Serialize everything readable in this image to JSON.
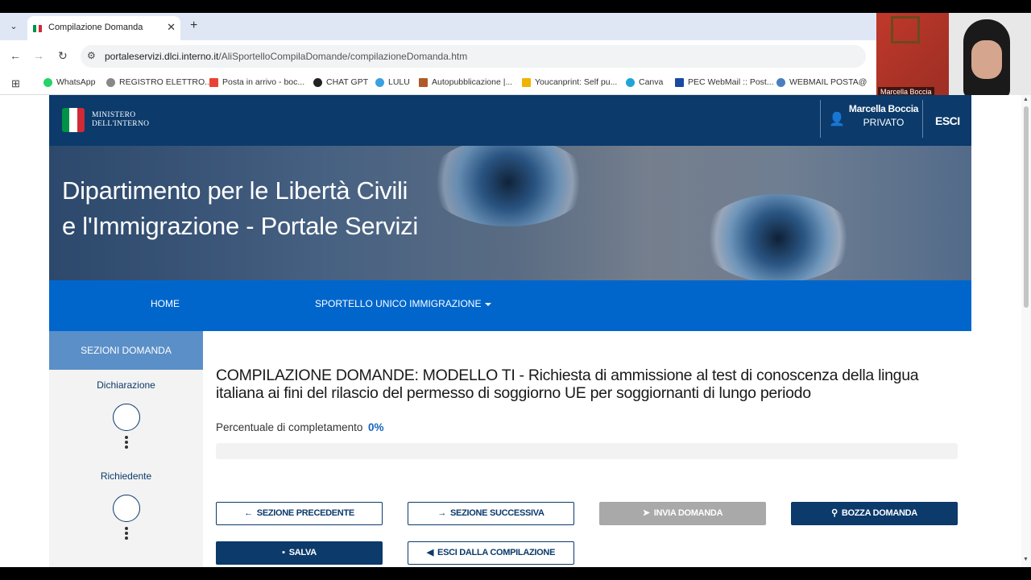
{
  "browser": {
    "tab_title": "Compilazione Domanda",
    "tab_close": "✕",
    "new_tab": "+",
    "url_host": "portaleservizi.dlci.interno.it",
    "url_path": "/AliSportelloCompilaDomande/compilazioneDomanda.htm",
    "bookmarks": [
      {
        "label": "WhatsApp",
        "color": "#25d366"
      },
      {
        "label": "REGISTRO ELETTRO...",
        "color": "#888888"
      },
      {
        "label": "Posta in arrivo - boc...",
        "color": "#ea4335"
      },
      {
        "label": "CHAT GPT",
        "color": "#222222"
      },
      {
        "label": "LULU",
        "color": "#3aa0e0"
      },
      {
        "label": "Autopubblicazione |...",
        "color": "#b05a2a"
      },
      {
        "label": "Youcanprint: Self pu...",
        "color": "#f0b400"
      },
      {
        "label": "Canva",
        "color": "#20a4d8"
      },
      {
        "label": "PEC WebMail :: Post...",
        "color": "#1a4aa0"
      },
      {
        "label": "WEBMAIL POSTA@",
        "color": "#4a7ec0"
      }
    ]
  },
  "webcam": {
    "name": "Marcella Boccia"
  },
  "header": {
    "logo_line1": "MINISTERO",
    "logo_line2": "DELL'INTERNO",
    "user_name": "Marcella Boccia",
    "user_role": "PRIVATO",
    "logout": "ESCI"
  },
  "hero": {
    "title_line1": "Dipartimento per le Libertà Civili",
    "title_line2": "e l'Immigrazione - Portale Servizi"
  },
  "nav": {
    "home": "HOME",
    "sportello": "SPORTELLO UNICO IMMIGRAZIONE"
  },
  "sidebar": {
    "header": "SEZIONI DOMANDA",
    "steps": [
      {
        "label": "Dichiarazione"
      },
      {
        "label": "Richiedente"
      }
    ]
  },
  "main": {
    "title": "COMPILAZIONE DOMANDE: MODELLO TI - Richiesta di ammissione al test di conoscenza della lingua italiana ai fini del rilascio del permesso di soggiorno UE per soggiornanti di lungo periodo",
    "progress_label": "Percentuale di completamento",
    "progress_value": "0%",
    "progress_fraction": 0
  },
  "buttons": {
    "prev": "SEZIONE PRECEDENTE",
    "next": "SEZIONE SUCCESSIVA",
    "send": "INVIA DOMANDA",
    "draft": "BOZZA DOMANDA",
    "save": "SALVA",
    "exit": "ESCI DALLA COMPILAZIONE"
  },
  "colors": {
    "header_bg": "#0b3a6b",
    "nav_bg": "#0066cc",
    "sidebar_head": "#5b8fc7",
    "accent": "#1565c0"
  }
}
